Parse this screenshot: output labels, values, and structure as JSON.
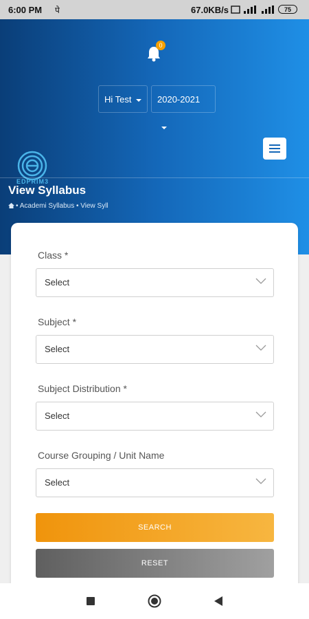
{
  "status_bar": {
    "time": "6:00 PM",
    "glyph": "पे",
    "speed": "67.0KB/s",
    "battery": "75"
  },
  "header": {
    "notification_count": "0",
    "user_dropdown": "Hi Test",
    "year_dropdown": "2020-2021",
    "logo_text": "EDPRIM3"
  },
  "page": {
    "title": "View Syllabus",
    "breadcrumb": "• Academi    Syllabus • View Syll"
  },
  "form": {
    "fields": [
      {
        "label": "Class *",
        "value": "Select"
      },
      {
        "label": "Subject *",
        "value": "Select"
      },
      {
        "label": "Subject Distribution *",
        "value": "Select"
      },
      {
        "label": "Course Grouping / Unit Name",
        "value": "Select"
      }
    ],
    "search_label": "SEARCH",
    "reset_label": "RESET"
  },
  "colors": {
    "header_gradient_start": "#0a3e78",
    "header_gradient_end": "#1f8fe6",
    "search_button": "#f0940c",
    "reset_button": "#707070"
  },
  "icons": [
    "bell-icon",
    "menu-icon",
    "home-icon",
    "chevron-down-icon",
    "recents-icon",
    "home-nav-icon",
    "back-icon"
  ]
}
